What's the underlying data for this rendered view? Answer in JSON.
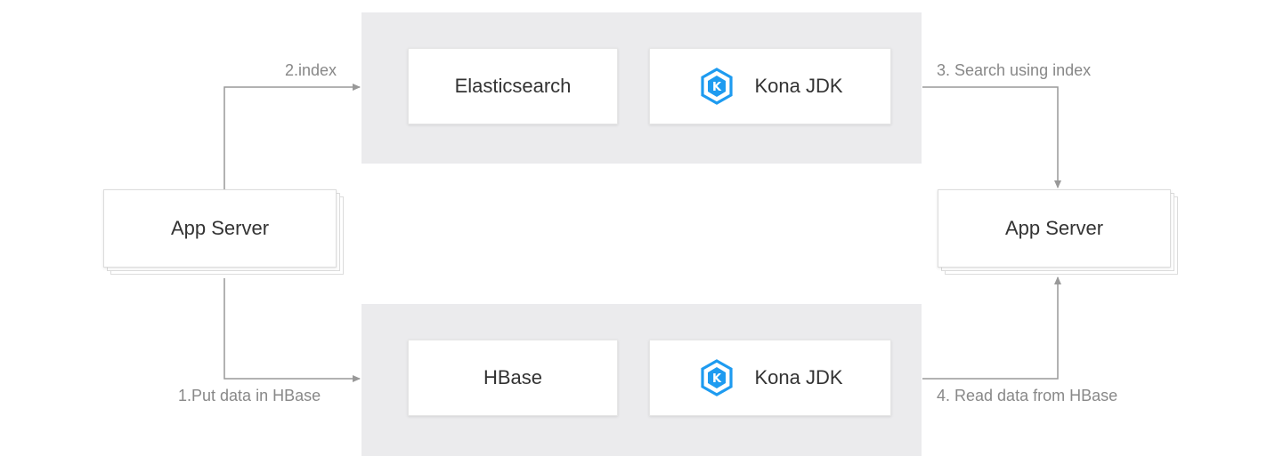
{
  "colors": {
    "panel": "#ebebed",
    "arrow": "#999999",
    "icon": "#1e9bf0",
    "text": "#333333",
    "label": "#888888"
  },
  "top_panel": {
    "left_box": {
      "label": "Elasticsearch"
    },
    "right_box": {
      "label": "Kona JDK",
      "icon": "kona-jdk-icon"
    }
  },
  "bottom_panel": {
    "left_box": {
      "label": "HBase"
    },
    "right_box": {
      "label": "Kona JDK",
      "icon": "kona-jdk-icon"
    }
  },
  "left_server": {
    "label": "App Server"
  },
  "right_server": {
    "label": "App Server"
  },
  "edges": {
    "index": "2.index",
    "search": "3. Search using index",
    "put": "1.Put data in HBase",
    "read": "4. Read data from HBase"
  }
}
